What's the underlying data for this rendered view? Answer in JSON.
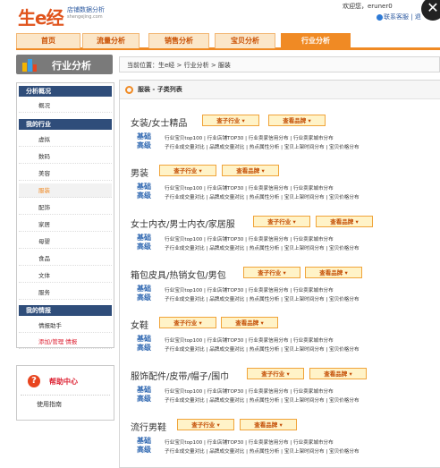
{
  "header": {
    "logo": "生e经",
    "logo_sub_cn": "店铺数据分析",
    "logo_sub_en": "shengejing.com",
    "welcome": "欢迎您，eruner0",
    "contact": "联系客服 | 退",
    "close": "✕"
  },
  "nav": {
    "tabs": [
      "首页",
      "流量分析",
      "销售分析",
      "宝贝分析",
      "行业分析"
    ],
    "active": 4
  },
  "sidebar": {
    "title": "行业分析",
    "sections": [
      {
        "title": "分析概况",
        "items": [
          "概况"
        ]
      },
      {
        "title": "我的行业",
        "items": [
          "虚拟",
          "数码",
          "美容",
          "服装",
          "配饰",
          "家居",
          "母婴",
          "食品",
          "文体",
          "服务"
        ]
      },
      {
        "title": "我的情报",
        "items": [
          "情报助手",
          "添加/管理 情报"
        ]
      }
    ],
    "current_item": "服装"
  },
  "help": {
    "title": "帮助中心",
    "item": "使用指南"
  },
  "breadcrumb": "当前位置：生e经 > 行业分析 > 服装",
  "main": {
    "title": "服装 - 子类列表",
    "btn_sub": "查子行业 ▾",
    "btn_brand": "查看品牌 ▾",
    "label_basic": "基础",
    "label_advanced": "高级",
    "links_basic": "行业宝贝top100 | 行业店铺TOP30 | 行业卖家信用分布 | 行业卖家城市分布",
    "links_advanced": "子行业成交量对比 | 品牌成交量对比 | 热点属性分析 | 宝贝上架时间分布 | 宝贝价格分布",
    "categories": [
      "女装/女士精品",
      "男装",
      "女士内衣/男士内衣/家居服",
      "箱包皮具/热销女包/男包",
      "女鞋",
      "服饰配件/皮带/帽子/围巾",
      "流行男鞋"
    ]
  },
  "colors": {
    "accent": "#f08a24",
    "sidebar_section": "#2f4d7a",
    "link_blue": "#2d66b0",
    "logo": "#e0531b"
  }
}
